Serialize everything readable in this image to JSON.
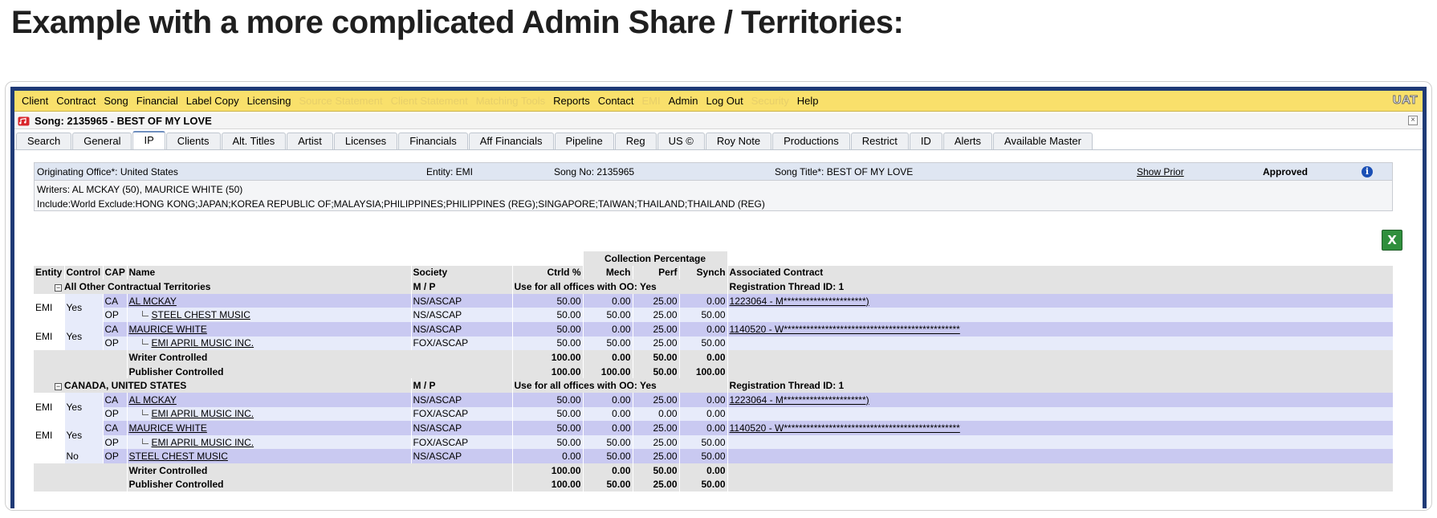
{
  "heading": "Example with a more complicated Admin Share / Territories:",
  "menu": [
    {
      "label": "Client",
      "enabled": true
    },
    {
      "label": "Contract",
      "enabled": true
    },
    {
      "label": "Song",
      "enabled": true
    },
    {
      "label": "Financial",
      "enabled": true
    },
    {
      "label": "Label Copy",
      "enabled": true
    },
    {
      "label": "Licensing",
      "enabled": true
    },
    {
      "label": "Source Statement",
      "enabled": false
    },
    {
      "label": "Client Statement",
      "enabled": false
    },
    {
      "label": "Matching Tools",
      "enabled": false
    },
    {
      "label": "Reports",
      "enabled": true
    },
    {
      "label": "Contact",
      "enabled": true
    },
    {
      "label": "EMI",
      "enabled": false
    },
    {
      "label": "Admin",
      "enabled": true
    },
    {
      "label": "Log Out",
      "enabled": true
    },
    {
      "label": "Security",
      "enabled": false
    },
    {
      "label": "Help",
      "enabled": true
    }
  ],
  "env_badge": "UAT",
  "window_title": "Song: 2135965 - BEST OF MY LOVE",
  "close_glyph": "×",
  "tabs": [
    "Search",
    "General",
    "IP",
    "Clients",
    "Alt. Titles",
    "Artist",
    "Licenses",
    "Financials",
    "Aff Financials",
    "Pipeline",
    "Reg",
    "US ©",
    "Roy Note",
    "Productions",
    "Restrict",
    "ID",
    "Alerts",
    "Available Master"
  ],
  "active_tab": "IP",
  "info": {
    "originating_office": "Originating Office*: United States",
    "entity": "Entity: EMI",
    "song_no": "Song No: 2135965",
    "song_title": "Song Title*: BEST OF MY LOVE",
    "show_prior": "Show Prior",
    "status": "Approved",
    "info_glyph": "i",
    "writers": "Writers: AL MCKAY (50), MAURICE WHITE (50)",
    "territories": "Include:World Exclude:HONG KONG;JAPAN;KOREA REPUBLIC OF;MALAYSIA;PHILIPPINES;PHILIPPINES (REG);SINGAPORE;TAIWAN;THAILAND;THAILAND (REG)"
  },
  "excel_glyph": "X",
  "table": {
    "group_header": "Collection Percentage",
    "columns": {
      "entity": "Entity",
      "control": "Control",
      "cap": "CAP",
      "name": "Name",
      "society": "Society",
      "ctrld": "Ctrld %",
      "mech": "Mech",
      "perf": "Perf",
      "synch": "Synch",
      "contract": "Associated Contract"
    },
    "sections": [
      {
        "toggle": "−",
        "title": "All Other Contractual Territories",
        "mp": "M / P",
        "offices": "Use for all offices with OO: Yes",
        "thread": "Registration Thread ID: 1",
        "groups": [
          {
            "entity": "EMI",
            "control": "Yes",
            "rows": [
              {
                "cap": "CA",
                "name": "AL MCKAY",
                "indent": false,
                "society": "NS/ASCAP",
                "ctrld": "50.00",
                "mech": "0.00",
                "perf": "25.00",
                "synch": "0.00",
                "contract": "1223064 - M**********************)"
              },
              {
                "cap": "OP",
                "name": "STEEL CHEST MUSIC",
                "indent": true,
                "society": "NS/ASCAP",
                "ctrld": "50.00",
                "mech": "50.00",
                "perf": "25.00",
                "synch": "50.00",
                "contract": ""
              }
            ]
          },
          {
            "entity": "EMI",
            "control": "Yes",
            "rows": [
              {
                "cap": "CA",
                "name": "MAURICE WHITE",
                "indent": false,
                "society": "NS/ASCAP",
                "ctrld": "50.00",
                "mech": "0.00",
                "perf": "25.00",
                "synch": "0.00",
                "contract": "1140520 - W***********************************************"
              },
              {
                "cap": "OP",
                "name": "EMI APRIL MUSIC INC.",
                "indent": true,
                "society": "FOX/ASCAP",
                "ctrld": "50.00",
                "mech": "50.00",
                "perf": "25.00",
                "synch": "50.00",
                "contract": ""
              }
            ]
          }
        ],
        "totals": [
          {
            "label": "Writer Controlled",
            "ctrld": "100.00",
            "mech": "0.00",
            "perf": "50.00",
            "synch": "0.00"
          },
          {
            "label": "Publisher Controlled",
            "ctrld": "100.00",
            "mech": "100.00",
            "perf": "50.00",
            "synch": "100.00"
          }
        ]
      },
      {
        "toggle": "−",
        "title": "CANADA, UNITED STATES",
        "mp": "M / P",
        "offices": "Use for all offices with OO: Yes",
        "thread": "Registration Thread ID: 1",
        "groups": [
          {
            "entity": "EMI",
            "control": "Yes",
            "rows": [
              {
                "cap": "CA",
                "name": "AL MCKAY",
                "indent": false,
                "society": "NS/ASCAP",
                "ctrld": "50.00",
                "mech": "0.00",
                "perf": "25.00",
                "synch": "0.00",
                "contract": "1223064 - M**********************)"
              },
              {
                "cap": "OP",
                "name": "EMI APRIL MUSIC INC.",
                "indent": true,
                "society": "FOX/ASCAP",
                "ctrld": "50.00",
                "mech": "0.00",
                "perf": "0.00",
                "synch": "0.00",
                "contract": ""
              }
            ]
          },
          {
            "entity": "EMI",
            "control": "Yes",
            "rows": [
              {
                "cap": "CA",
                "name": "MAURICE WHITE",
                "indent": false,
                "society": "NS/ASCAP",
                "ctrld": "50.00",
                "mech": "0.00",
                "perf": "25.00",
                "synch": "0.00",
                "contract": "1140520 - W***********************************************"
              },
              {
                "cap": "OP",
                "name": "EMI APRIL MUSIC INC.",
                "indent": true,
                "society": "FOX/ASCAP",
                "ctrld": "50.00",
                "mech": "50.00",
                "perf": "25.00",
                "synch": "50.00",
                "contract": ""
              }
            ]
          },
          {
            "entity": "",
            "control": "No",
            "rows": [
              {
                "cap": "OP",
                "name": "STEEL CHEST MUSIC",
                "indent": false,
                "society": "NS/ASCAP",
                "ctrld": "0.00",
                "mech": "50.00",
                "perf": "25.00",
                "synch": "50.00",
                "contract": ""
              }
            ]
          }
        ],
        "totals": [
          {
            "label": "Writer Controlled",
            "ctrld": "100.00",
            "mech": "0.00",
            "perf": "50.00",
            "synch": "0.00"
          },
          {
            "label": "Publisher Controlled",
            "ctrld": "100.00",
            "mech": "50.00",
            "perf": "25.00",
            "synch": "50.00"
          }
        ]
      }
    ]
  }
}
